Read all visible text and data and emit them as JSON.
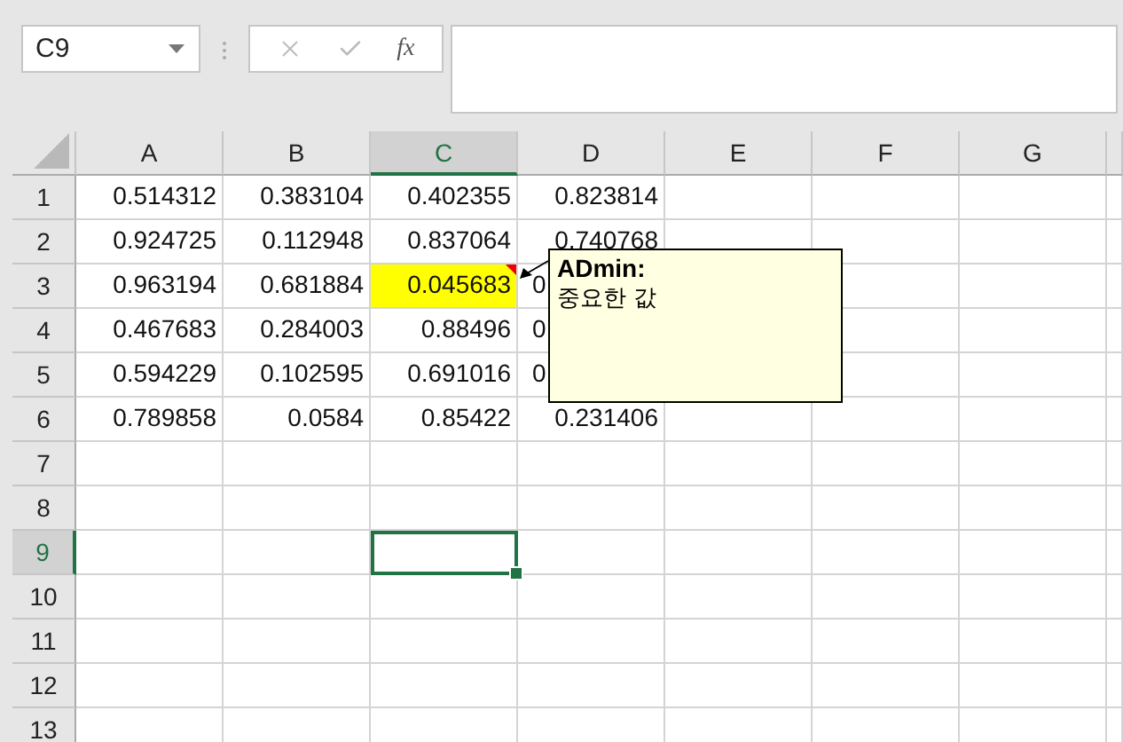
{
  "name_box": {
    "value": "C9"
  },
  "formula_bar": {
    "function_label": "fx"
  },
  "columns": [
    {
      "label": "A",
      "selected": false
    },
    {
      "label": "B",
      "selected": false
    },
    {
      "label": "C",
      "selected": true
    },
    {
      "label": "D",
      "selected": false
    },
    {
      "label": "E",
      "selected": false
    },
    {
      "label": "F",
      "selected": false
    },
    {
      "label": "G",
      "selected": false
    }
  ],
  "rows": [
    {
      "label": "1",
      "selected": false,
      "cells": [
        {
          "kind": "number",
          "value": "0.514312"
        },
        {
          "kind": "number",
          "value": "0.383104"
        },
        {
          "kind": "number",
          "value": "0.402355"
        },
        {
          "kind": "number",
          "value": "0.823814"
        }
      ]
    },
    {
      "label": "2",
      "selected": false,
      "cells": [
        {
          "kind": "number",
          "value": "0.924725"
        },
        {
          "kind": "number",
          "value": "0.112948"
        },
        {
          "kind": "number",
          "value": "0.837064"
        },
        {
          "kind": "number",
          "value": "0.740768"
        }
      ]
    },
    {
      "label": "3",
      "selected": false,
      "cells": [
        {
          "kind": "number",
          "value": "0.963194"
        },
        {
          "kind": "number",
          "value": "0.681884"
        },
        {
          "kind": "number",
          "value": "0.045683",
          "color": "#ffff00",
          "comment": {
            "author": "ADmin:",
            "text": "중요한 값"
          }
        },
        {
          "kind": "clipped",
          "value": "0"
        }
      ]
    },
    {
      "label": "4",
      "selected": false,
      "cells": [
        {
          "kind": "number",
          "value": "0.467683"
        },
        {
          "kind": "number",
          "value": "0.284003"
        },
        {
          "kind": "number",
          "value": "0.88496"
        },
        {
          "kind": "clipped",
          "value": "0"
        }
      ]
    },
    {
      "label": "5",
      "selected": false,
      "cells": [
        {
          "kind": "number",
          "value": "0.594229"
        },
        {
          "kind": "number",
          "value": "0.102595"
        },
        {
          "kind": "number",
          "value": "0.691016"
        },
        {
          "kind": "clipped",
          "value": "0"
        }
      ]
    },
    {
      "label": "6",
      "selected": false,
      "cells": [
        {
          "kind": "number",
          "value": "0.789858"
        },
        {
          "kind": "number",
          "value": "0.0584"
        },
        {
          "kind": "number",
          "value": "0.85422"
        },
        {
          "kind": "number",
          "value": "0.231406"
        }
      ]
    },
    {
      "label": "7",
      "selected": false
    },
    {
      "label": "8",
      "selected": false
    },
    {
      "label": "9",
      "selected": true
    },
    {
      "label": "10",
      "selected": false
    },
    {
      "label": "11",
      "selected": false
    },
    {
      "label": "12",
      "selected": false
    },
    {
      "label": "13",
      "selected": false
    }
  ]
}
